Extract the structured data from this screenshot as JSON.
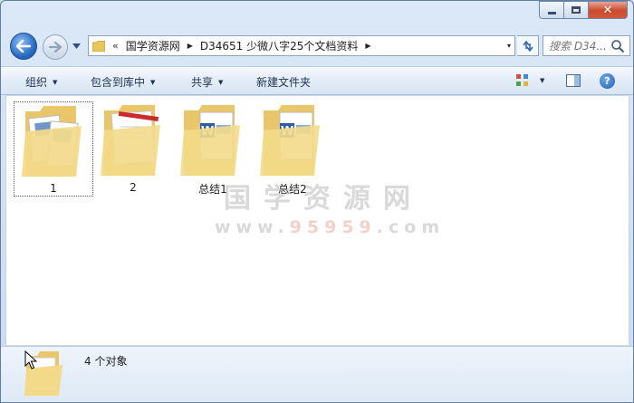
{
  "window": {
    "caption": {
      "close_glyph": "✕"
    }
  },
  "address_bar": {
    "overflow": "«",
    "crumbs": [
      "国学资源网",
      "D34651 少微八字25个文档资料"
    ],
    "dropdown": "▾"
  },
  "search": {
    "placeholder": "搜索 D34..."
  },
  "command_bar": {
    "organize": "组织",
    "include_library": "包含到库中",
    "share": "共享",
    "new_folder": "新建文件夹",
    "caret": "▼"
  },
  "help": {
    "glyph": "?"
  },
  "items": [
    {
      "label": "1",
      "icon": "folder-with-documents-icon",
      "selected": true
    },
    {
      "label": "2",
      "icon": "folder-with-pages-icon",
      "selected": false
    },
    {
      "label": "总结1",
      "icon": "folder-with-word-icon",
      "selected": false
    },
    {
      "label": "总结2",
      "icon": "folder-with-word-icon",
      "selected": false
    }
  ],
  "watermark": {
    "title": "国学资源网",
    "url_prefix": "www.",
    "url_highlight": "95959",
    "url_suffix": ".com"
  },
  "status": {
    "count": "4 个对象"
  },
  "colors": {
    "accent": "#2a6cc4",
    "folder": "#f0d57a",
    "close": "#c94a2c"
  }
}
